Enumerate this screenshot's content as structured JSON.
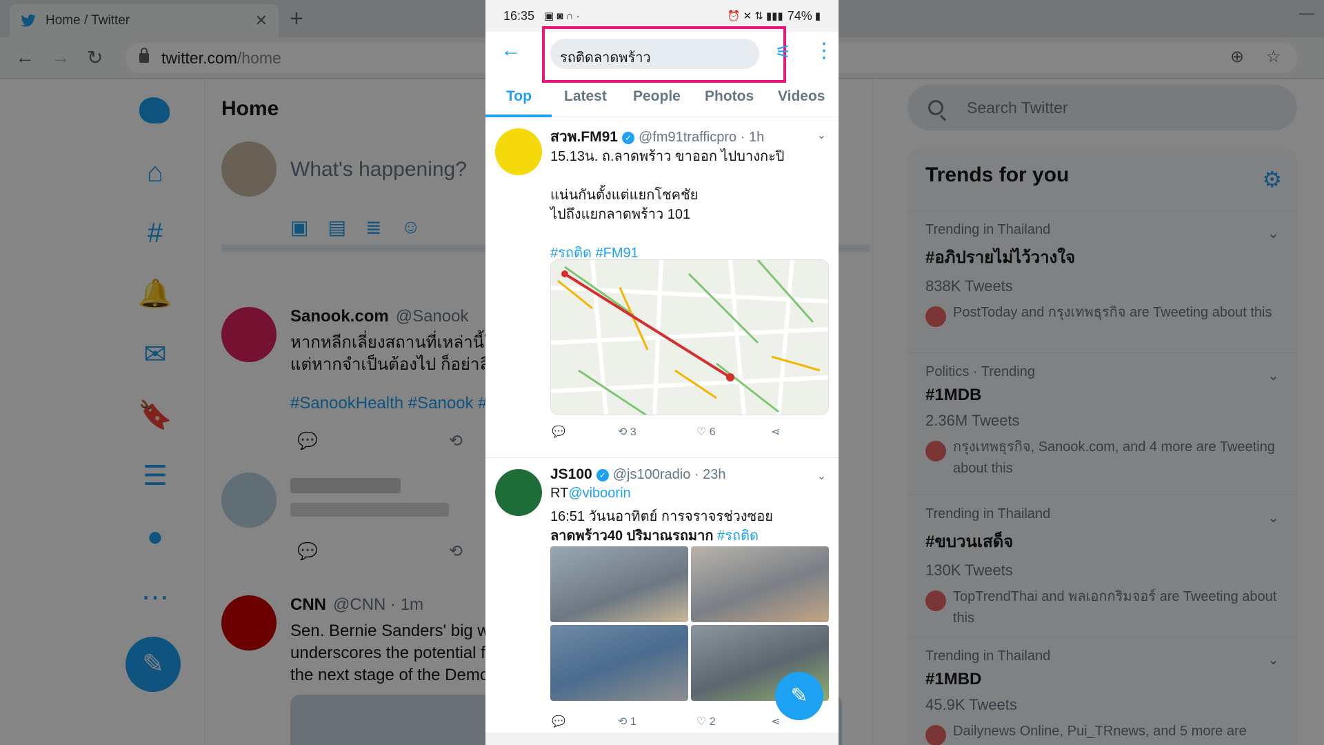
{
  "browser": {
    "tab_title": "Home / Twitter",
    "url_host": "twitter.com",
    "url_path": "/home"
  },
  "twitter": {
    "home_title": "Home",
    "compose_placeholder": "What's happening?",
    "timeline": [
      {
        "name": "Sanook.com",
        "handle": "@Sanook",
        "lines": [
          "หากหลีกเลี่ยงสถานที่เหล่านี้ใ",
          "แต่หากจำเป็นต้องไป ก็อย่าลื"
        ],
        "tags": "#SanookHealth #Sanook #"
      },
      {
        "name": "CNN",
        "handle": "@CNN · 1m",
        "lines": [
          "Sen. Bernie Sanders' big wi",
          "underscores the potential f",
          "the next stage of the Demo"
        ],
        "tags": ""
      }
    ],
    "search_placeholder": "Search Twitter",
    "trends_title": "Trends for you",
    "trends": [
      {
        "category": "Trending in Thailand",
        "name": "#อภิปรายไม่ไว้วางใจ",
        "count": "838K Tweets",
        "who": "PostToday and กรุงเทพธุรกิจ are Tweeting about this"
      },
      {
        "category": "Politics · Trending",
        "name": "#1MDB",
        "count": "2.36M Tweets",
        "who": "กรุงเทพธุรกิจ, Sanook.com, and 4 more are Tweeting about this"
      },
      {
        "category": "Trending in Thailand",
        "name": "#ขบวนเสด็จ",
        "count": "130K Tweets",
        "who": "TopTrendThai and พลเอกกริมจอร์ are Tweeting about this"
      },
      {
        "category": "Trending in Thailand",
        "name": "#1MBD",
        "count": "45.9K Tweets",
        "who": "Dailynews Online, Pui_TRnews, and 5 more are"
      }
    ]
  },
  "phone": {
    "time": "16:35",
    "battery": "74%",
    "search_query": "รถติดลาดพร้าว",
    "tabs": [
      "Top",
      "Latest",
      "People",
      "Photos",
      "Videos"
    ],
    "tweets": [
      {
        "name": "สวพ.FM91",
        "handle": "@fm91trafficpro · 1h",
        "lines": [
          "15.13น. ถ.ลาดพร้าว ขาออก ไปบางกะปิ",
          "",
          "แน่นกันตั้งแต่แยกโชคชัย",
          "ไปถึงแยกลาดพร้าว 101",
          "",
          ""
        ],
        "hashtags": "#รถติด #FM91",
        "retweets": "3",
        "likes": "6"
      },
      {
        "name": "JS100",
        "handle": "@js100radio · 23h",
        "rt_prefix": "RT",
        "rt_user": "@viboorin",
        "line2": "16:51 วันนอาทิตย์ การจราจรช่วงซอย",
        "line3": "ลาดพร้าว40 ปริมาณรถมาก ",
        "line3_tag": "#รถติด",
        "retweets": "1",
        "likes": "2"
      }
    ]
  }
}
